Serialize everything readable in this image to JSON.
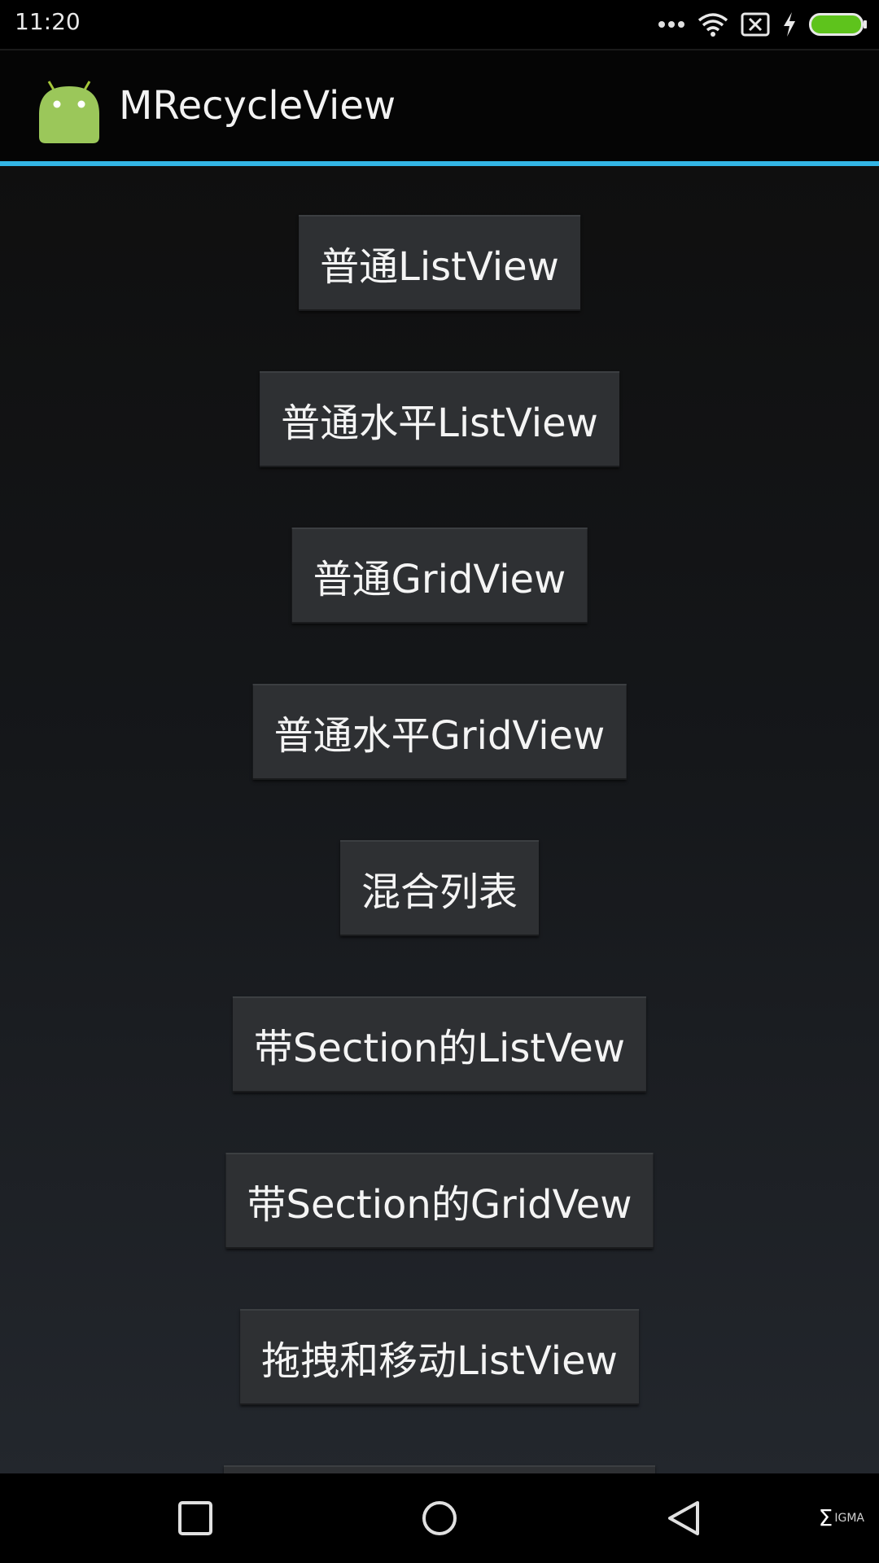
{
  "status_bar": {
    "time": "11:20",
    "battery_color": "#5ec31c"
  },
  "action_bar": {
    "title": "MRecycleView",
    "accent_color": "#33b5e5",
    "app_icon": "android-robot-icon"
  },
  "buttons": [
    {
      "label": "普通ListView"
    },
    {
      "label": "普通水平ListView"
    },
    {
      "label": "普通GridView"
    },
    {
      "label": "普通水平GridView"
    },
    {
      "label": "混合列表"
    },
    {
      "label": "带Section的ListVew"
    },
    {
      "label": "带Section的GridVew"
    },
    {
      "label": "拖拽和移动ListView"
    }
  ],
  "nav_bar": {
    "recents_icon": "square-icon",
    "home_icon": "circle-icon",
    "back_icon": "triangle-back-icon"
  },
  "watermark": {
    "sigma": "Σ",
    "text": "IGMA"
  }
}
